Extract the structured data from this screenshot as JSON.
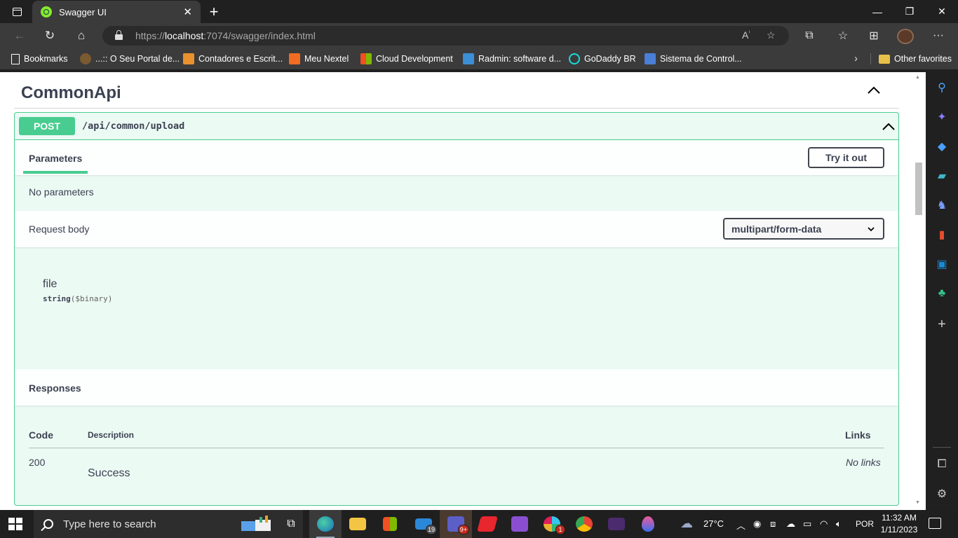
{
  "browser": {
    "tab_title": "Swagger UI",
    "url_scheme": "https://",
    "url_host": "localhost",
    "url_rest": ":7074/swagger/index.html",
    "new_tab_icon": "plus-icon",
    "window_controls": [
      "minimize",
      "restore",
      "close"
    ]
  },
  "bookmarks": [
    {
      "label": "Bookmarks",
      "icon": "bookmarks-icon",
      "color": "#ffffff"
    },
    {
      "label": "...:: O Seu Portal de...",
      "icon": "portal-icon",
      "color": "#c8a060"
    },
    {
      "label": "Contadores e Escrit...",
      "icon": "google-plus-icon",
      "color": "#e8912d"
    },
    {
      "label": "Meu Nextel",
      "icon": "nextel-icon",
      "color": "#ef6c22"
    },
    {
      "label": "Cloud Development",
      "icon": "microsoft-icon",
      "color": "#f25022"
    },
    {
      "label": "Radmin: software d...",
      "icon": "radmin-icon",
      "color": "#3a8fd6"
    },
    {
      "label": "GoDaddy BR",
      "icon": "godaddy-icon",
      "color": "#1bdbdb"
    },
    {
      "label": "Sistema de Control...",
      "icon": "sistema-icon",
      "color": "#4a7fd8"
    }
  ],
  "other_favorites": "Other favorites",
  "swagger": {
    "section_title": "CommonApi",
    "method": "POST",
    "path": "/api/common/upload",
    "parameters_tab": "Parameters",
    "try_it_out": "Try it out",
    "no_parameters": "No parameters",
    "request_body_label": "Request body",
    "content_type": "multipart/form-data",
    "field_name": "file",
    "field_type": "string",
    "field_format": "($binary)",
    "responses_title": "Responses",
    "columns": {
      "code": "Code",
      "description": "Description",
      "links": "Links"
    },
    "responses": [
      {
        "code": "200",
        "description": "Success",
        "links": "No links"
      }
    ],
    "colors": {
      "post": "#49cc90",
      "text": "#3b4151"
    }
  },
  "sidebar_icons": [
    "search-icon",
    "copilot-icon",
    "shopping-tag-icon",
    "tools-icon",
    "games-icon",
    "office-icon",
    "outlook-icon",
    "tree-icon",
    "add-icon",
    "split-screen-icon",
    "settings-icon"
  ],
  "taskbar": {
    "search_placeholder": "Type here to search",
    "apps": [
      {
        "name": "task-view-icon"
      },
      {
        "name": "edge-icon",
        "active": true
      },
      {
        "name": "file-explorer-icon"
      },
      {
        "name": "store-icon"
      },
      {
        "name": "mail-icon",
        "badge": "19"
      },
      {
        "name": "teams-icon",
        "badge": "9+"
      },
      {
        "name": "filezilla-icon"
      },
      {
        "name": "visual-studio-icon"
      },
      {
        "name": "slack-icon",
        "badge": "1"
      },
      {
        "name": "chrome-icon"
      },
      {
        "name": "terminal-icon"
      },
      {
        "name": "paint-drop-icon"
      }
    ],
    "weather": "27°C",
    "language": "POR",
    "time": "11:32 AM",
    "date": "1/11/2023"
  }
}
